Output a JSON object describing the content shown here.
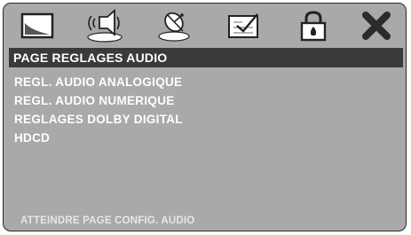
{
  "toolbar": {
    "icons": [
      "general-setup-icon",
      "audio-setup-icon",
      "video-setup-icon",
      "preference-setup-icon",
      "password-lock-icon",
      "exit-icon"
    ]
  },
  "page": {
    "title": "PAGE REGLAGES AUDIO"
  },
  "menu": {
    "items": [
      "REGL. AUDIO ANALOGIQUE",
      "REGL. AUDIO NUMERIQUE",
      "REGLAGES DOLBY DIGITAL",
      "HDCD"
    ]
  },
  "status": {
    "text": "ATTEINDRE PAGE CONFIG. AUDIO"
  }
}
